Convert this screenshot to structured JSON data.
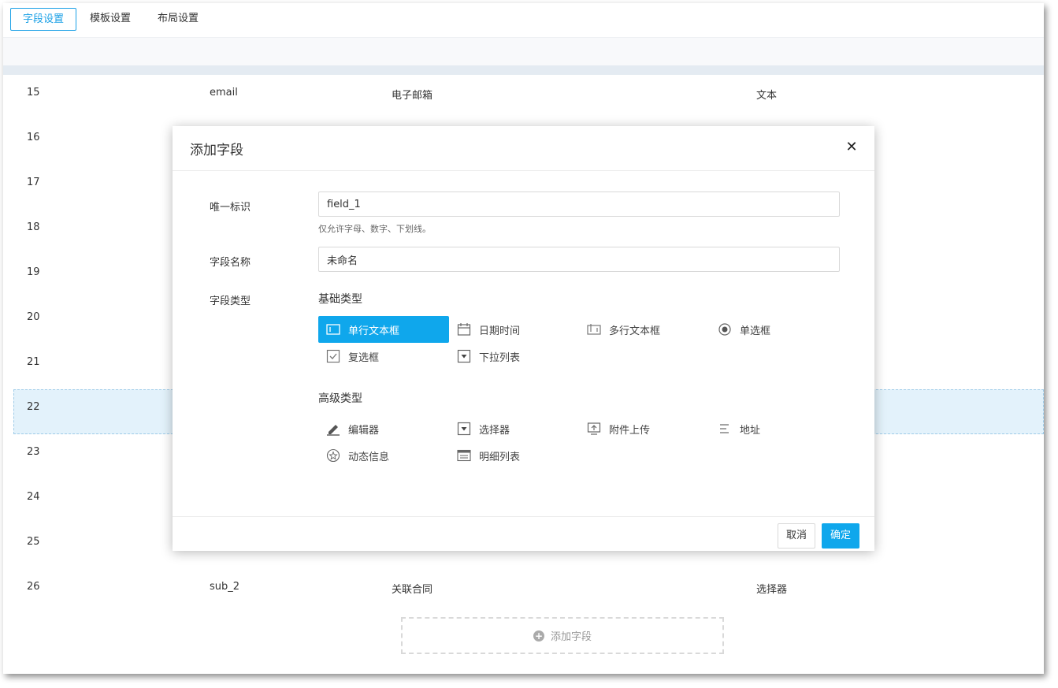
{
  "tabs": [
    {
      "label": "字段设置",
      "active": true
    },
    {
      "label": "模板设置",
      "active": false
    },
    {
      "label": "布局设置",
      "active": false
    }
  ],
  "rows": [
    {
      "index": "15",
      "key": "email",
      "name": "电子邮箱",
      "type": "文本"
    },
    {
      "index": "16",
      "key": "",
      "name": "",
      "type": ""
    },
    {
      "index": "17",
      "key": "",
      "name": "",
      "type": ""
    },
    {
      "index": "18",
      "key": "",
      "name": "",
      "type": ""
    },
    {
      "index": "19",
      "key": "",
      "name": "",
      "type": ""
    },
    {
      "index": "20",
      "key": "",
      "name": "",
      "type": ""
    },
    {
      "index": "21",
      "key": "",
      "name": "",
      "type": ""
    },
    {
      "index": "22",
      "key": "",
      "name": "",
      "type": "",
      "highlight": true
    },
    {
      "index": "23",
      "key": "",
      "name": "",
      "type": ""
    },
    {
      "index": "24",
      "key": "",
      "name": "",
      "type": ""
    },
    {
      "index": "25",
      "key": "",
      "name": "",
      "type": ""
    },
    {
      "index": "26",
      "key": "sub_2",
      "name": "关联合同",
      "type": "选择器"
    }
  ],
  "add_field_label": "添加字段",
  "modal": {
    "title": "添加字段",
    "close_icon": "close-icon",
    "id_label": "唯一标识",
    "id_value": "field_1",
    "id_hint": "仅允许字母、数字、下划线。",
    "name_label": "字段名称",
    "name_value": "未命名",
    "type_label": "字段类型",
    "basic_title": "基础类型",
    "advanced_title": "高级类型",
    "basic_types": [
      {
        "label": "单行文本框",
        "icon": "single-line-text-icon",
        "selected": true
      },
      {
        "label": "日期时间",
        "icon": "calendar-icon",
        "selected": false
      },
      {
        "label": "多行文本框",
        "icon": "multi-line-text-icon",
        "selected": false
      },
      {
        "label": "单选框",
        "icon": "radio-icon",
        "selected": false
      },
      {
        "label": "复选框",
        "icon": "checkbox-icon",
        "selected": false
      },
      {
        "label": "下拉列表",
        "icon": "dropdown-icon",
        "selected": false
      }
    ],
    "advanced_types": [
      {
        "label": "编辑器",
        "icon": "editor-icon"
      },
      {
        "label": "选择器",
        "icon": "selector-icon"
      },
      {
        "label": "附件上传",
        "icon": "upload-icon"
      },
      {
        "label": "地址",
        "icon": "address-icon"
      },
      {
        "label": "动态信息",
        "icon": "dynamic-info-icon"
      },
      {
        "label": "明细列表",
        "icon": "detail-list-icon"
      }
    ],
    "cancel_label": "取消",
    "ok_label": "确定"
  },
  "colors": {
    "accent": "#0fa7ec",
    "tab_active": "#1aa0e6",
    "highlight_row": "#e3f2fb"
  }
}
